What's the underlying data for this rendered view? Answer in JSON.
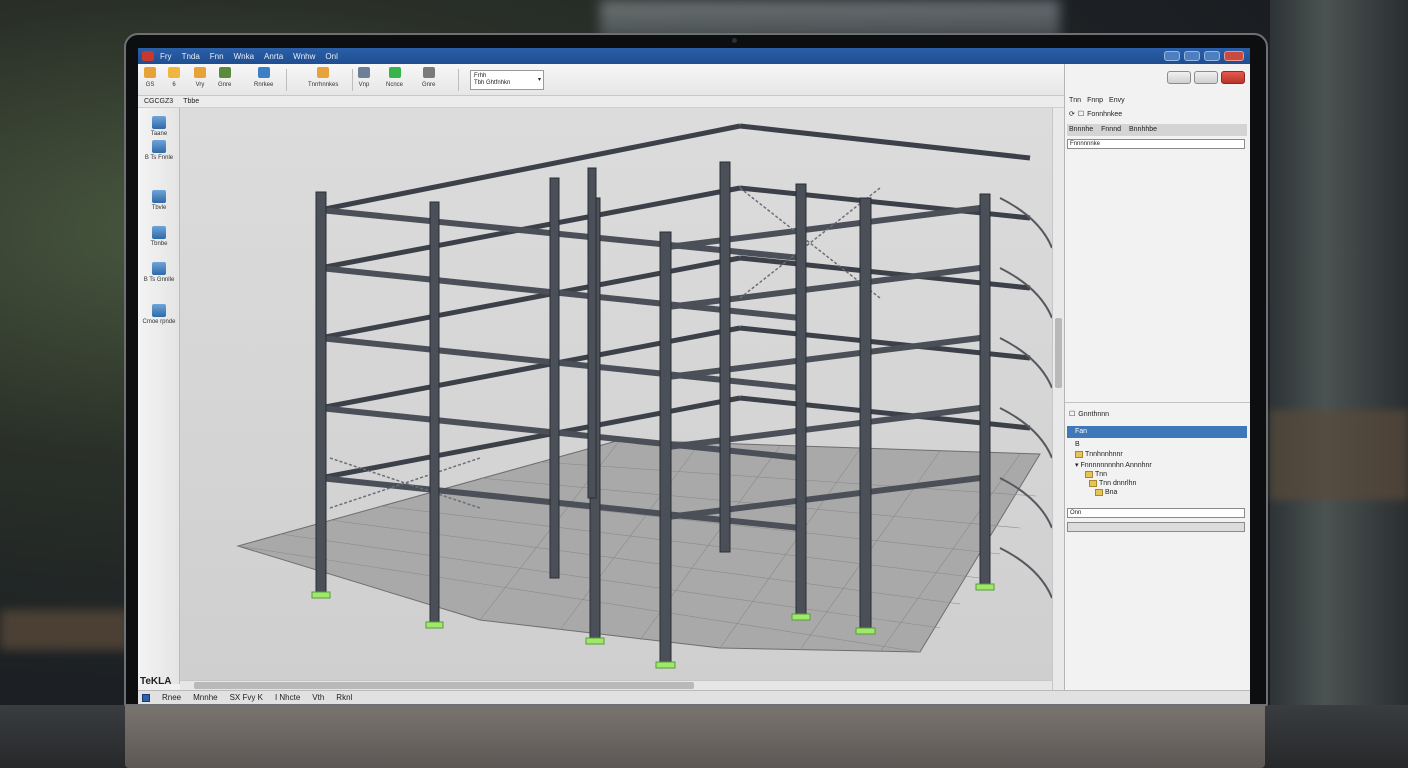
{
  "window": {
    "menu": [
      "Fry",
      "Tnda",
      "Fnn",
      "Wnka",
      "Anrta",
      "Wnhw",
      "Onl"
    ]
  },
  "toolbar": {
    "groups": [
      {
        "label": "GS",
        "icon_color": "#e8a23a"
      },
      {
        "label": "6",
        "icon_color": "#f0b640"
      },
      {
        "label": "Vry",
        "icon_color": "#e8a23a"
      },
      {
        "label": "Gnre",
        "icon_color": "#5a8a3c"
      },
      {
        "label": "Rnrkee",
        "icon_color": "#3d7fc4"
      },
      {
        "label": "Tnrrhnnkes",
        "icon_color": "#e8a23a"
      },
      {
        "label": "Vnp",
        "icon_color": "#6b7f99"
      },
      {
        "label": "Ncnce",
        "icon_color": "#38b54a"
      },
      {
        "label": "Gnre",
        "icon_color": "#7a7a7a"
      }
    ],
    "select": {
      "line1": "Frhh",
      "line2": "Tbh Ghtfnhkn"
    }
  },
  "subbar": {
    "items": [
      "CGCGZ3",
      "Tbbe"
    ]
  },
  "left_tools": [
    {
      "label": "Taane",
      "icon": "folder-blue-icon"
    },
    {
      "label": "B Ts Fnnle",
      "icon": "part-icon"
    },
    {
      "label": "Tbvle",
      "icon": "beam-icon"
    },
    {
      "label": "Tbnbe",
      "icon": "column-icon"
    },
    {
      "label": "B Ts Gnnlle",
      "icon": "plate-icon"
    },
    {
      "label": "Cmoe rpnde",
      "icon": "bolt-icon"
    }
  ],
  "status": {
    "logo": "TeKLA",
    "items": [
      "Rnee",
      "Mnnhe",
      "SX Fvy K",
      "I Nhcte",
      "Vth",
      "Rknl"
    ]
  },
  "right_panel": {
    "menu": [
      "Tnn",
      "Fnnp",
      "Envy"
    ],
    "search_row": "Fonnhnkee",
    "header": [
      "Bnnnhe",
      "Fnnnd",
      "Bnnhhbe"
    ],
    "field1": "Fnnnnnnke",
    "tree_title": "Gnnthnnn",
    "selected": "Fan",
    "tree": [
      "B",
      "Tnnhnnhnnr",
      "Fnnnnnnnnhn Annnhnr",
      "Tnn",
      "Tnn dnnrlhn",
      "Bna"
    ],
    "combo": "Onn"
  },
  "colors": {
    "titlebar": "#1f4e91",
    "selection": "#3e78b8",
    "steel": "#4a4f58",
    "anchor": "#9ee86a"
  }
}
